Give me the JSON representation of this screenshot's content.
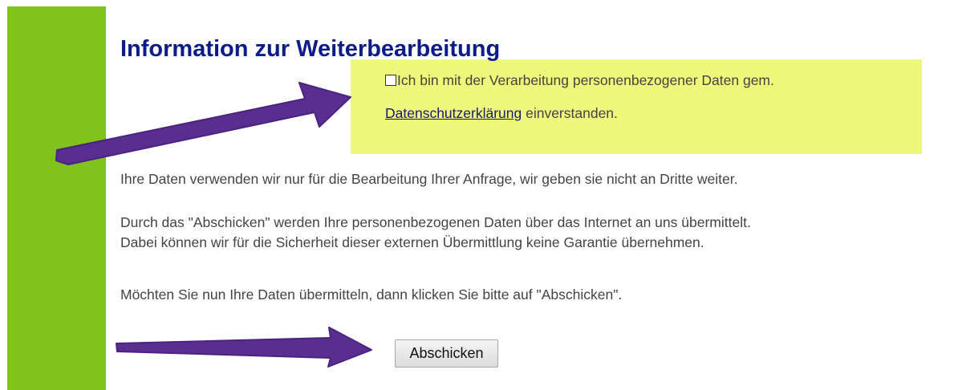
{
  "heading": "Information zur Weiterbearbeitung",
  "consent": {
    "checkbox_checked": false,
    "text_before_link": "Ich bin mit der Verarbeitung personenbezogener Daten gem.",
    "link_text": "Datenschutzerklärung",
    "text_after_link": " einverstanden."
  },
  "paragraphs": {
    "p1": "Ihre Daten verwenden wir nur für die Bearbeitung Ihrer Anfrage, wir geben sie nicht an Dritte weiter.",
    "p2_line1": "Durch das \"Abschicken\" werden Ihre personenbezogenen Daten über das Internet an uns übermittelt.",
    "p2_line2": "Dabei können wir für die Sicherheit dieser externen Übermittlung keine Garantie übernehmen.",
    "p3": "Möchten Sie nun Ihre Daten übermitteln, dann klicken Sie bitte auf \"Abschicken\"."
  },
  "submit_button": {
    "label": "Abschicken"
  },
  "colors": {
    "sidebar_green": "#7fc31c",
    "consent_highlight": "#eef87a",
    "heading_blue": "#0c1b8a",
    "arrow_purple": "#5a2d91"
  },
  "icons": {
    "pointer_arrow_1": "arrow-right-icon",
    "pointer_arrow_2": "arrow-right-icon"
  }
}
